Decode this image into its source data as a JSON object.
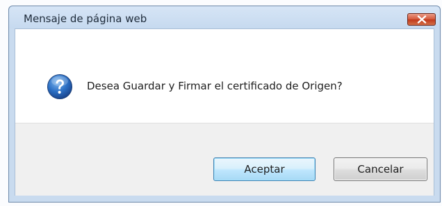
{
  "dialog": {
    "title": "Mensaje de página web",
    "message": "Desea Guardar y Firmar el certificado de Origen?",
    "icon": "question-icon",
    "buttons": {
      "accept_label": "Aceptar",
      "cancel_label": "Cancelar"
    },
    "colors": {
      "close_button": "#c7432a",
      "accent": "#3c7fb1"
    }
  }
}
